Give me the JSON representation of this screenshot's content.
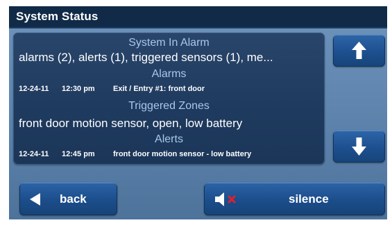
{
  "window": {
    "title": "System Status"
  },
  "status": {
    "system_heading": "System In Alarm",
    "system_summary": "alarms (2), alerts (1), triggered sensors (1), me...",
    "alarms_heading": "Alarms",
    "alarms": [
      {
        "date": "12-24-11",
        "time": "12:30 pm",
        "description": "Exit / Entry #1: front door"
      }
    ],
    "zones_heading": "Triggered Zones",
    "zones_summary": "front door motion sensor, open, low battery",
    "alerts_heading": "Alerts",
    "alerts": [
      {
        "date": "12-24-11",
        "time": "12:45 pm",
        "description": "front door motion sensor - low battery"
      }
    ]
  },
  "controls": {
    "back_label": "back",
    "silence_label": "silence"
  },
  "icons": {
    "scroll_up": "arrow-up-icon",
    "scroll_down": "arrow-down-icon",
    "back": "triangle-left-icon",
    "silence": "speaker-muted-icon"
  },
  "colors": {
    "title_bar": "#102a47",
    "panel_background": "#5d82ab",
    "content_box": "#1e3a5e",
    "heading_text": "#a9c8ea",
    "button": "#1d4f8e",
    "mute_x": "#e0202a"
  }
}
